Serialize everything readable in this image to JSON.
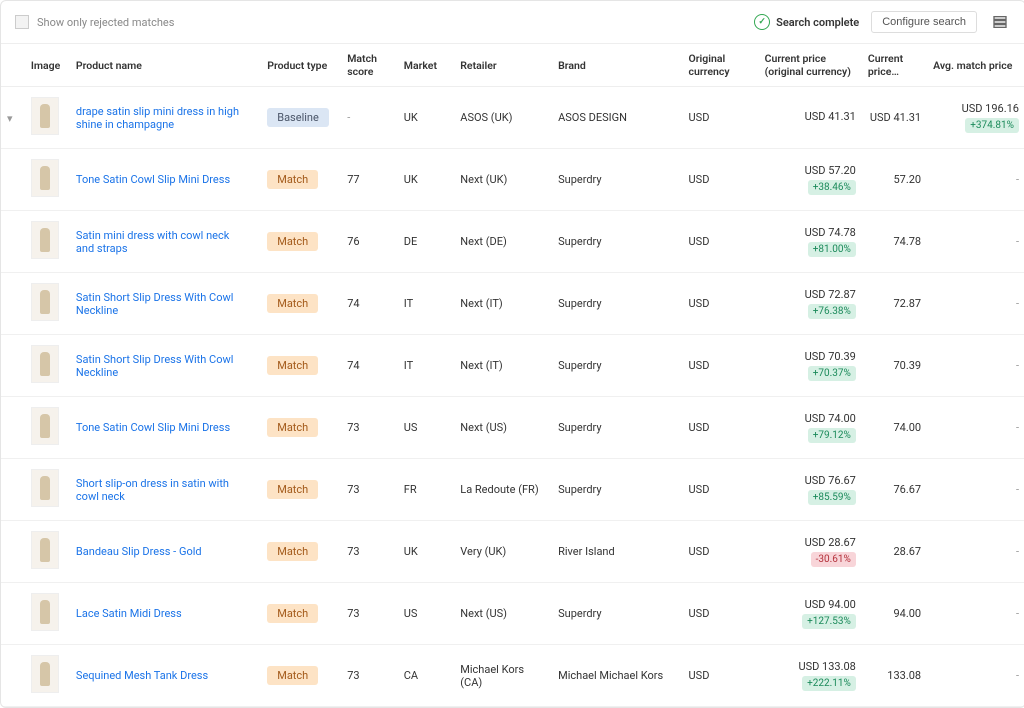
{
  "topbar": {
    "checkbox_label": "Show only rejected matches",
    "status": "Search complete",
    "config_button": "Configure search"
  },
  "headers": {
    "image": "Image",
    "product_name": "Product name",
    "product_type": "Product type",
    "match_score": "Match score",
    "market": "Market",
    "retailer": "Retailer",
    "brand": "Brand",
    "original_currency": "Original currency",
    "current_price_original": "Current price (original currency)",
    "current_price": "Current price…",
    "avg_match_price": "Avg. match price"
  },
  "badges": {
    "baseline": "Baseline",
    "match": "Match"
  },
  "rows": [
    {
      "expandable": true,
      "name": "drape satin slip mini dress in high shine in champagne",
      "type": "baseline",
      "score": "-",
      "market": "UK",
      "retailer": "ASOS (UK)",
      "brand": "ASOS DESIGN",
      "ocur": "USD",
      "ocp": "USD 41.31",
      "ocp_pct": "",
      "cp": "USD 41.31",
      "amp": "USD 196.16",
      "amp_pct": "+374.81%"
    },
    {
      "name": "Tone Satin Cowl Slip Mini Dress",
      "type": "match",
      "score": "77",
      "market": "UK",
      "retailer": "Next (UK)",
      "brand": "Superdry",
      "ocur": "USD",
      "ocp": "USD 57.20",
      "ocp_pct": "+38.46%",
      "cp": "57.20",
      "amp": "-",
      "amp_pct": ""
    },
    {
      "name": "Satin mini dress with cowl neck and straps",
      "type": "match",
      "score": "76",
      "market": "DE",
      "retailer": "Next (DE)",
      "brand": "Superdry",
      "ocur": "USD",
      "ocp": "USD 74.78",
      "ocp_pct": "+81.00%",
      "cp": "74.78",
      "amp": "-",
      "amp_pct": ""
    },
    {
      "name": "Satin Short Slip Dress With Cowl Neckline",
      "type": "match",
      "score": "74",
      "market": "IT",
      "retailer": "Next (IT)",
      "brand": "Superdry",
      "ocur": "USD",
      "ocp": "USD 72.87",
      "ocp_pct": "+76.38%",
      "cp": "72.87",
      "amp": "-",
      "amp_pct": ""
    },
    {
      "name": "Satin Short Slip Dress With Cowl Neckline",
      "type": "match",
      "score": "74",
      "market": "IT",
      "retailer": "Next (IT)",
      "brand": "Superdry",
      "ocur": "USD",
      "ocp": "USD 70.39",
      "ocp_pct": "+70.37%",
      "cp": "70.39",
      "amp": "-",
      "amp_pct": ""
    },
    {
      "name": "Tone Satin Cowl Slip Mini Dress",
      "type": "match",
      "score": "73",
      "market": "US",
      "retailer": "Next (US)",
      "brand": "Superdry",
      "ocur": "USD",
      "ocp": "USD 74.00",
      "ocp_pct": "+79.12%",
      "cp": "74.00",
      "amp": "-",
      "amp_pct": ""
    },
    {
      "name": "Short slip-on dress in satin with cowl neck",
      "type": "match",
      "score": "73",
      "market": "FR",
      "retailer": "La Redoute (FR)",
      "brand": "Superdry",
      "ocur": "USD",
      "ocp": "USD 76.67",
      "ocp_pct": "+85.59%",
      "cp": "76.67",
      "amp": "-",
      "amp_pct": ""
    },
    {
      "name": "Bandeau Slip Dress - Gold",
      "type": "match",
      "score": "73",
      "market": "UK",
      "retailer": "Very (UK)",
      "brand": "River Island",
      "ocur": "USD",
      "ocp": "USD 28.67",
      "ocp_pct": "-30.61%",
      "cp": "28.67",
      "amp": "-",
      "amp_pct": ""
    },
    {
      "name": "Lace Satin Midi Dress",
      "type": "match",
      "score": "73",
      "market": "US",
      "retailer": "Next (US)",
      "brand": "Superdry",
      "ocur": "USD",
      "ocp": "USD 94.00",
      "ocp_pct": "+127.53%",
      "cp": "94.00",
      "amp": "-",
      "amp_pct": ""
    },
    {
      "name": "Sequined Mesh Tank Dress",
      "type": "match",
      "score": "73",
      "market": "CA",
      "retailer": "Michael Kors (CA)",
      "brand": "Michael Michael Kors",
      "ocur": "USD",
      "ocp": "USD 133.08",
      "ocp_pct": "+222.11%",
      "cp": "133.08",
      "amp": "-",
      "amp_pct": ""
    }
  ]
}
